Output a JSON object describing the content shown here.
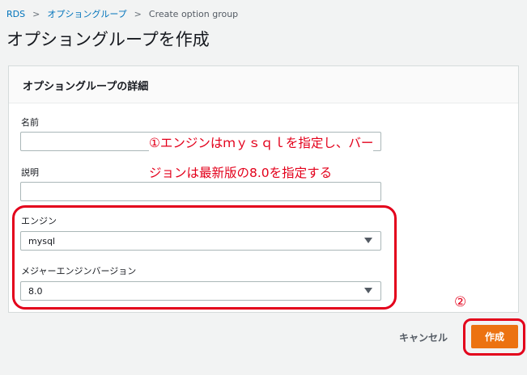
{
  "breadcrumb": {
    "items": [
      "RDS",
      "オプショングループ",
      "Create option group"
    ],
    "separator": ">"
  },
  "page": {
    "title": "オプショングループを作成"
  },
  "panel": {
    "title": "オプショングループの詳細",
    "fields": {
      "name": {
        "label": "名前",
        "value": ""
      },
      "description": {
        "label": "説明",
        "value": ""
      },
      "engine": {
        "label": "エンジン",
        "selected": "mysql"
      },
      "major_version": {
        "label": "メジャーエンジンバージョン",
        "selected": "8.0"
      }
    }
  },
  "annotations": {
    "note_line1": "①エンジンはｍｙｓｑｌを指定し、バー",
    "note_line2": "ジョンは最新版の8.0を指定する",
    "step2_marker": "②"
  },
  "actions": {
    "cancel_label": "キャンセル",
    "create_label": "作成"
  },
  "colors": {
    "accent_orange": "#ec7211",
    "annotation_red": "#e3001b",
    "link_blue": "#0073bb"
  }
}
